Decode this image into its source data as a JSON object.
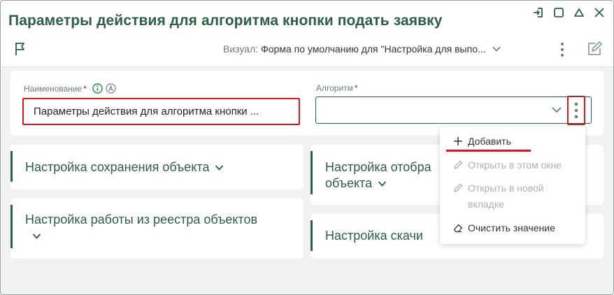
{
  "window": {
    "title": "Параметры действия для алгоритма кнопки подать заявку",
    "controls": [
      "restore-icon",
      "maximize-icon",
      "minimize-icon",
      "close-icon"
    ]
  },
  "toolbar": {
    "visual_label": "Визуал:",
    "visual_value": "Форма по умолчанию для \"Настройка для выпо..."
  },
  "fields": {
    "name": {
      "label": "Наименование",
      "required_mark": "*",
      "value": "Параметры действия для алгоритма кнопки ..."
    },
    "algorithm": {
      "label": "Алгоритм",
      "required_mark": "*",
      "value": ""
    }
  },
  "sections": {
    "save": "Настройка сохранения объекта",
    "display_line1": "Настройка отобра",
    "display_line2": "объекта",
    "registry": "Настройка работы из реестра объектов",
    "download": "Настройка скачи"
  },
  "menu": {
    "add": "Добавить",
    "open_here": "Открыть в этом окне",
    "open_new_line1": "Открыть в новой",
    "open_new_line2": "вкладке",
    "clear": "Очистить значение"
  },
  "colors": {
    "accent": "#2c5e48",
    "highlight": "#e0141e",
    "background": "#f1f3f2"
  }
}
